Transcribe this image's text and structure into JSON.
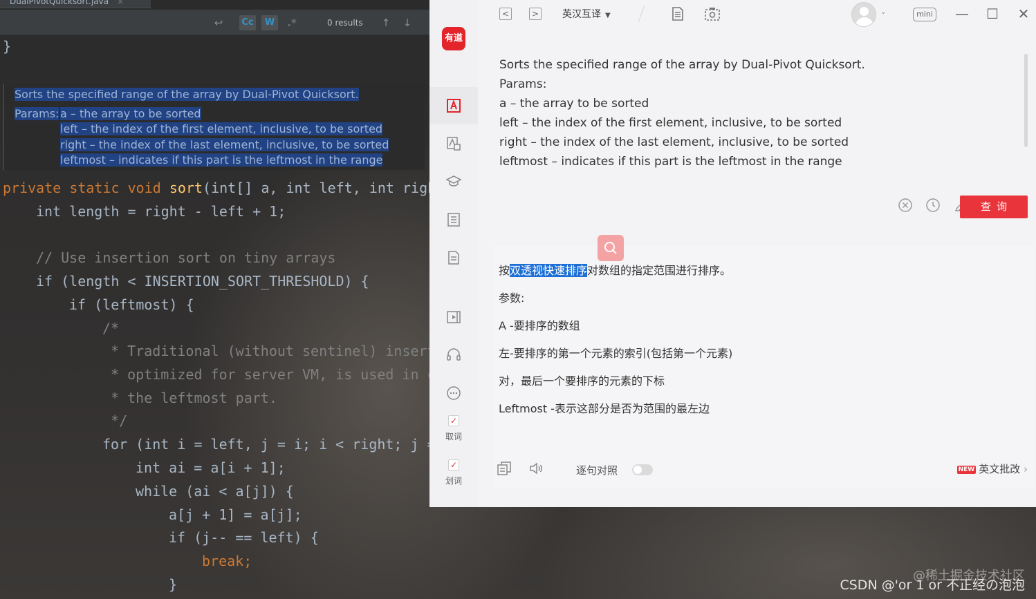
{
  "ide": {
    "tab_title": "DualPivotQuicksort.java",
    "tab_close": "×",
    "find_bar": {
      "case_toggle": "Cc",
      "word_toggle": "W",
      "regex_toggle": ".*",
      "results": "0 results"
    },
    "doc": {
      "line1": "Sorts the specified range of the array by Dual-Pivot Quicksort.",
      "params_label": "Params:",
      "param_a": "a – the array to be sorted",
      "param_left": "left – the index of the first element, inclusive, to be sorted",
      "param_right": "right – the index of the last element, inclusive, to be sorted",
      "param_leftmost": "leftmost – indicates if this part is the leftmost in the range"
    },
    "code": {
      "brace_close": "}",
      "sig_private": "private",
      "sig_static": "static",
      "sig_void": "void",
      "sig_name": "sort",
      "sig_rest": "(int[] a, int left, int righ",
      "length_line": "int length = right - left + 1;",
      "comment_use": "// Use insertion sort on tiny arrays",
      "if_length": "if (length < INSERTION_SORT_THRESHOLD) {",
      "if_leftmost": "if (leftmost) {",
      "c_open": "/*",
      "c_line1": " * Traditional (without sentinel) insert",
      "c_line2": " * optimized for server VM, is used in c",
      "c_line3": " * the leftmost part.",
      "c_close": " */",
      "for_line": "for (int i = left, j = i; i < right; j =",
      "ai_line": "int ai = a[i + 1];",
      "while_line": "while (ai < a[j]) {",
      "assign_line": "a[j + 1] = a[j];",
      "ifj_line": "if (j-- == left) {",
      "break_line": "break;",
      "close_line": "}"
    }
  },
  "youdao": {
    "logo": "有道",
    "sidebar": {
      "check_word_label": "取词",
      "select_word_label": "划词",
      "check_mark": "✓"
    },
    "topbar": {
      "back": "<",
      "forward": ">",
      "mode": "英汉互译",
      "mode_caret": "▼",
      "mini": "mini",
      "minimize": "—",
      "maximize": "☐",
      "close": "✕"
    },
    "source_lines": [
      "Sorts the specified range of the array by Dual-Pivot Quicksort.",
      "Params:",
      "a – the array to be sorted",
      "left – the index of the first element, inclusive, to be sorted",
      "right – the index of the last element, inclusive, to be sorted",
      "leftmost – indicates if this part is the leftmost in the range"
    ],
    "query_button": "查询",
    "result": {
      "line1_pre": "按",
      "line1_hl": "双透视快速排序",
      "line1_post": "对数组的指定范围进行排序。",
      "line2": "参数:",
      "line3": "A -要排序的数组",
      "line4": "左-要排序的第一个元素的索引(包括第一个元素)",
      "line5": "对，最后一个要排序的元素的下标",
      "line6": "Leftmost -表示这部分是否为范围的最左边"
    },
    "bottom": {
      "sentence_compare": "逐句对照",
      "new_badge": "NEW",
      "english_correction": "英文批改",
      "arrow": "›"
    }
  },
  "watermark": {
    "line1": "@稀土掘金技术社区",
    "line2": "CSDN @'or 1 or 不正经の泡泡"
  },
  "colors": {
    "youdao_red": "#e8343a",
    "ide_bg": "#2b2b2b",
    "selection_blue": "#214283"
  }
}
